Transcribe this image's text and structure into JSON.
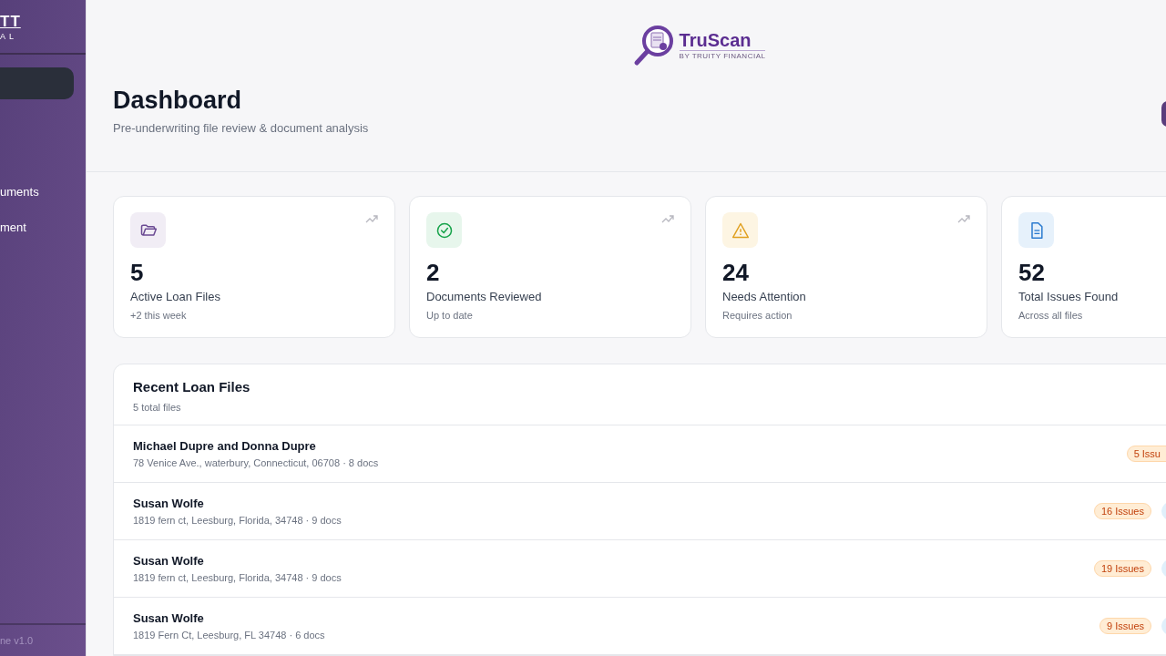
{
  "sidebar": {
    "brand_lines": [
      "TT",
      "AL"
    ],
    "nav_items": [
      {
        "selected": true
      },
      {
        "label": "uments",
        "selected": false
      },
      {
        "label": "ment",
        "selected": false
      }
    ],
    "footer": "ne v1.0"
  },
  "logo": {
    "name": "TruScan",
    "tagline": "BY TRUITY FINANCIAL"
  },
  "header": {
    "title": "Dashboard",
    "subtitle": "Pre-underwriting file review & document analysis"
  },
  "stats": [
    {
      "kind": "folder",
      "value": "5",
      "trend": true,
      "label": "Active Loan Files",
      "note": "+2 this week"
    },
    {
      "kind": "check",
      "value": "2",
      "trend": true,
      "label": "Documents Reviewed",
      "note": "Up to date"
    },
    {
      "kind": "warning",
      "value": "24",
      "trend": true,
      "label": "Needs Attention",
      "note": "Requires action"
    },
    {
      "kind": "document",
      "value": "52",
      "trend": false,
      "label": "Total Issues Found",
      "note": "Across all files"
    }
  ],
  "recent_files": {
    "title": "Recent Loan Files",
    "count": "5 total files",
    "rows": [
      {
        "name": "Michael Dupre and Donna Dupre",
        "details": "78 Venice Ave., waterbury, Connecticut, 06708 · 8 docs",
        "issues": "5 Issu",
        "status_badge": false
      },
      {
        "name": "Susan Wolfe",
        "details": "1819 fern ct, Leesburg, Florida, 34748 · 9 docs",
        "issues": "16 Issues",
        "status_badge": true
      },
      {
        "name": "Susan Wolfe",
        "details": "1819 fern ct, Leesburg, Florida, 34748 · 9 docs",
        "issues": "19 Issues",
        "status_badge": true
      },
      {
        "name": "Susan Wolfe",
        "details": "1819 Fern Ct, Leesburg, FL 34748 · 6 docs",
        "issues": "9 Issues",
        "status_badge": true
      }
    ]
  }
}
